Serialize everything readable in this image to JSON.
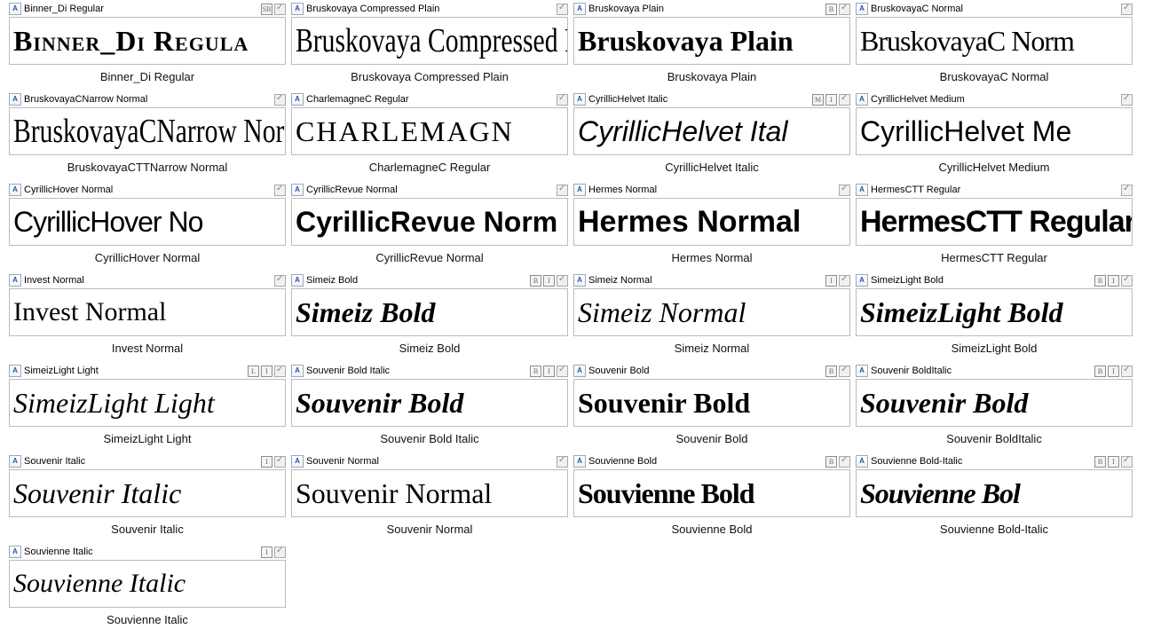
{
  "fonts": [
    {
      "label": "Binner_Di Regular",
      "preview": "Binner_Di Regula",
      "caption": "Binner_Di Regular",
      "cls": "f-binner",
      "badges": [
        "SB"
      ]
    },
    {
      "label": "Bruskovaya Compressed Plain",
      "preview": "Bruskovaya Compressed Pla",
      "caption": "Bruskovaya Compressed Plain",
      "cls": "f-bruskcomp",
      "badges": []
    },
    {
      "label": "Bruskovaya Plain",
      "preview": "Bruskovaya Plain",
      "caption": "Bruskovaya Plain",
      "cls": "f-bruskplain",
      "badges": [
        "B"
      ]
    },
    {
      "label": "BruskovayaC Normal",
      "preview": "BruskovayaC Norm",
      "caption": "BruskovayaC Normal",
      "cls": "f-bruskc",
      "badges": []
    },
    {
      "label": "BruskovayaCNarrow Normal",
      "preview": "BruskovayaCNarrow Norma",
      "caption": "BruskovayaCTTNarrow Normal",
      "cls": "f-brusknarrow",
      "badges": []
    },
    {
      "label": "CharlemagneC Regular",
      "preview": "CHARLEMAGN",
      "caption": "CharlemagneC Regular",
      "cls": "f-charle",
      "badges": []
    },
    {
      "label": "CyrillicHelvet Italic",
      "preview": "CyrillicHelvet Ital",
      "caption": "CyrillicHelvet Italic",
      "cls": "f-cyrhelvit",
      "badges": [
        "M",
        "I"
      ]
    },
    {
      "label": "CyrillicHelvet Medium",
      "preview": "CyrillicHelvet Me",
      "caption": "CyrillicHelvet Medium",
      "cls": "f-cyrhelvme",
      "badges": []
    },
    {
      "label": "CyrillicHover Normal",
      "preview": "CyrillicHover No",
      "caption": "CyrillicHover Normal",
      "cls": "f-cyrhover",
      "badges": []
    },
    {
      "label": "CyrillicRevue Normal",
      "preview": "CyrillicRevue Norm",
      "caption": "CyrillicRevue Normal",
      "cls": "f-cyrrevue",
      "badges": []
    },
    {
      "label": "Hermes Normal",
      "preview": "Hermes Normal",
      "caption": "Hermes Normal",
      "cls": "f-hermes",
      "badges": []
    },
    {
      "label": "HermesCTT Regular",
      "preview": "HermesCTT Regular",
      "caption": "HermesCTT Regular",
      "cls": "f-hermesctt",
      "badges": []
    },
    {
      "label": "Invest Normal",
      "preview": "Invest   Normal",
      "caption": "Invest Normal",
      "cls": "f-invest",
      "badges": []
    },
    {
      "label": "Simeiz Bold",
      "preview": "Simeiz  Bold",
      "caption": "Simeiz Bold",
      "cls": "f-simeizb",
      "badges": [
        "B",
        "I"
      ]
    },
    {
      "label": "Simeiz Normal",
      "preview": "Simeiz  Normal",
      "caption": "Simeiz Normal",
      "cls": "f-simeizn",
      "badges": [
        "I"
      ]
    },
    {
      "label": "SimeizLight Bold",
      "preview": "SimeizLight  Bold",
      "caption": "SimeizLight Bold",
      "cls": "f-simeizlb",
      "badges": [
        "B",
        "I"
      ]
    },
    {
      "label": "SimeizLight Light",
      "preview": "SimeizLight  Light",
      "caption": "SimeizLight Light",
      "cls": "f-simeizll",
      "badges": [
        "L",
        "I"
      ]
    },
    {
      "label": "Souvenir Bold Italic",
      "preview": "Souvenir  Bold",
      "caption": "Souvenir Bold Italic",
      "cls": "f-souvbi",
      "badges": [
        "B",
        "I"
      ]
    },
    {
      "label": "Souvenir Bold",
      "preview": "Souvenir Bold",
      "caption": "Souvenir Bold",
      "cls": "f-souvb",
      "badges": [
        "B"
      ]
    },
    {
      "label": "Souvenir BoldItalic",
      "preview": "Souvenir Bold",
      "caption": "Souvenir BoldItalic",
      "cls": "f-souvbi2",
      "badges": [
        "B",
        "I"
      ]
    },
    {
      "label": "Souvenir Italic",
      "preview": "Souvenir Italic",
      "caption": "Souvenir Italic",
      "cls": "f-souvi",
      "badges": [
        "I"
      ]
    },
    {
      "label": "Souvenir Normal",
      "preview": "Souvenir Normal",
      "caption": "Souvenir Normal",
      "cls": "f-souvn",
      "badges": []
    },
    {
      "label": "Souvienne Bold",
      "preview": "Souvienne Bold",
      "caption": "Souvienne Bold",
      "cls": "f-souvieb",
      "badges": [
        "B"
      ]
    },
    {
      "label": "Souvienne Bold-Italic",
      "preview": "Souvienne Bol",
      "caption": "Souvienne Bold-Italic",
      "cls": "f-souviebi",
      "badges": [
        "B",
        "I"
      ]
    },
    {
      "label": "Souvienne Italic",
      "preview": "Souvienne Italic",
      "caption": "Souvienne Italic",
      "cls": "f-souviei",
      "badges": [
        "I"
      ]
    }
  ],
  "icon_glyph": "A"
}
